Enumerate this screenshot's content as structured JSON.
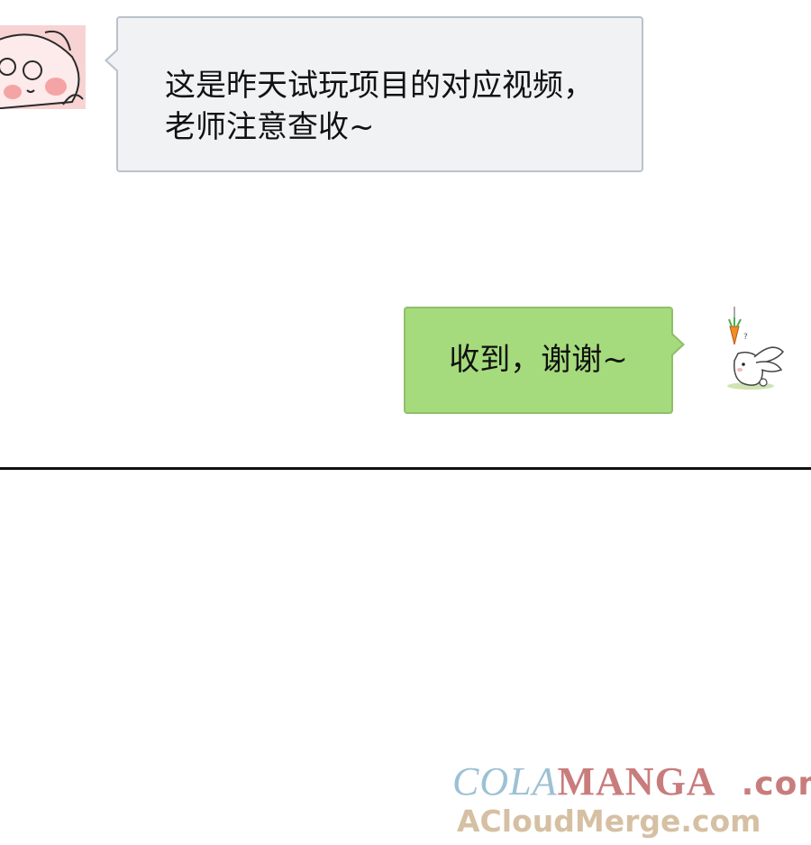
{
  "messages": [
    {
      "side": "left",
      "lines": [
        "这是昨天试玩项目的对应视频，",
        "老师注意查收~"
      ]
    },
    {
      "side": "right",
      "text": "收到，谢谢~"
    }
  ],
  "watermark": {
    "part1": "COLA",
    "part2": "MANGA",
    "part3": ".com",
    "line2": "ACloudMerge.com"
  },
  "colors": {
    "left_bubble": "#f1f2f4",
    "right_bubble": "#a5db7c",
    "avatar_left_bg": "#f8d3d3"
  },
  "icons": {
    "avatar_left": "pink-bunny-face-icon",
    "avatar_right": "white-rabbit-with-carrot-icon"
  }
}
